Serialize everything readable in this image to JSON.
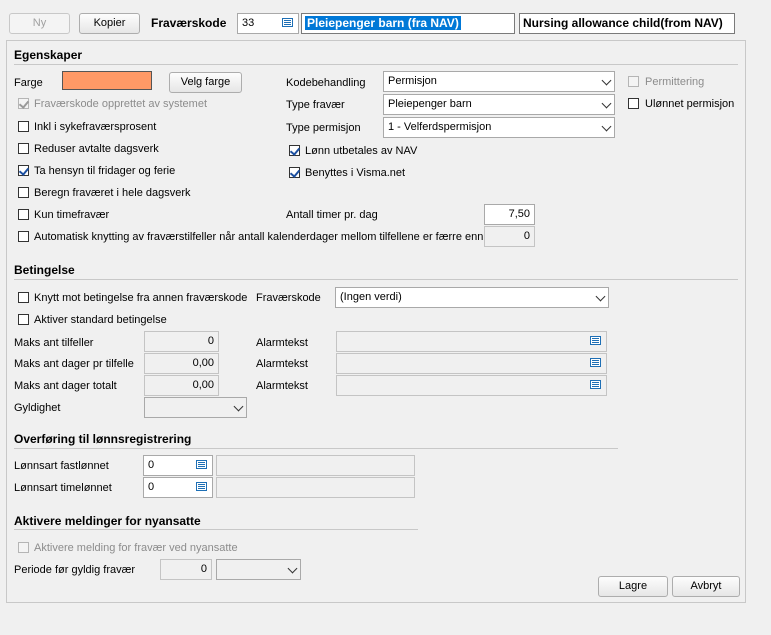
{
  "toolbar": {
    "new_label": "Ny",
    "copy_label": "Kopier",
    "code_label": "Fraværskode",
    "code_value": "33",
    "name_no": "Pleiepenger barn (fra NAV)",
    "name_en": "Nursing allowance child(from NAV)"
  },
  "egenskaper": {
    "title": "Egenskaper",
    "color_label": "Farge",
    "color_value": "#ff9966",
    "choose_color_label": "Velg farge",
    "checkboxes": [
      {
        "label": "Fraværskode opprettet av systemet",
        "checked": true,
        "disabled": true
      },
      {
        "label": "Inkl i sykefraværsprosent",
        "checked": false
      },
      {
        "label": "Reduser avtalte dagsverk",
        "checked": false
      },
      {
        "label": "Ta hensyn til fridager og ferie",
        "checked": true
      },
      {
        "label": "Beregn fraværet i hele dagsverk",
        "checked": false
      },
      {
        "label": "Kun timefravær",
        "checked": false
      },
      {
        "label": "Automatisk knytting av fraværstilfeller når antall kalenderdager mellom tilfellene er færre enn",
        "checked": false
      }
    ],
    "kodebehandling_label": "Kodebehandling",
    "kodebehandling_value": "Permisjon",
    "type_fravaer_label": "Type fravær",
    "type_fravaer_value": "Pleiepenger barn",
    "type_permisjon_label": "Type permisjon",
    "type_permisjon_value": "1 - Velferdspermisjon",
    "lonn_nav_label": "Lønn utbetales av NAV",
    "visma_label": "Benyttes i Visma.net",
    "permittering_label": "Permittering",
    "ulonnet_label": "Ulønnet permisjon",
    "timer_label": "Antall timer pr. dag",
    "timer_value": "7,50",
    "auto_days_value": "0"
  },
  "betingelse": {
    "title": "Betingelse",
    "knytt_label": "Knytt mot betingelse fra annen fraværskode",
    "fravaerskode_label": "Fraværskode",
    "fravaerskode_value": "(Ingen verdi)",
    "aktiver_label": "Aktiver standard betingelse",
    "rows": [
      {
        "label": "Maks ant tilfeller",
        "value": "0",
        "alarm_label": "Alarmtekst"
      },
      {
        "label": "Maks ant dager pr tilfelle",
        "value": "0,00",
        "alarm_label": "Alarmtekst"
      },
      {
        "label": "Maks ant dager totalt",
        "value": "0,00",
        "alarm_label": "Alarmtekst"
      }
    ],
    "gyldighet_label": "Gyldighet"
  },
  "overforing": {
    "title": "Overføring til lønnsregistrering",
    "fast_label": "Lønnsart fastlønnet",
    "fast_value": "0",
    "time_label": "Lønnsart timelønnet",
    "time_value": "0"
  },
  "aktivere": {
    "title": "Aktivere meldinger for nyansatte",
    "melding_label": "Aktivere melding for fravær ved nyansatte",
    "periode_label": "Periode før gyldig fravær",
    "periode_value": "0"
  },
  "footer": {
    "save_label": "Lagre",
    "cancel_label": "Avbryt"
  }
}
